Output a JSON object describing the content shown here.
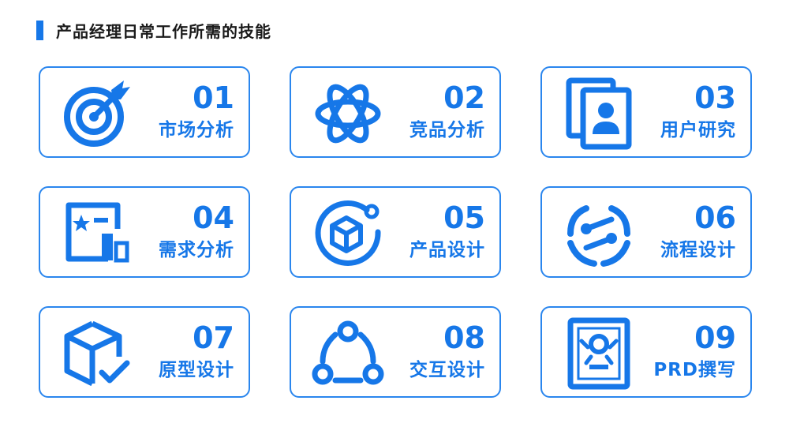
{
  "header": {
    "title": "产品经理日常工作所需的技能"
  },
  "colors": {
    "accent": "#1677e8",
    "border": "#2a86ee"
  },
  "cards": [
    {
      "number": "01",
      "label": "市场分析",
      "icon": "target-icon"
    },
    {
      "number": "02",
      "label": "竞品分析",
      "icon": "atom-icon"
    },
    {
      "number": "03",
      "label": "用户研究",
      "icon": "user-profile-icon"
    },
    {
      "number": "04",
      "label": "需求分析",
      "icon": "requirement-chart-icon"
    },
    {
      "number": "05",
      "label": "产品设计",
      "icon": "cube-orbit-icon"
    },
    {
      "number": "06",
      "label": "流程设计",
      "icon": "flow-cycle-icon"
    },
    {
      "number": "07",
      "label": "原型设计",
      "icon": "box-check-icon"
    },
    {
      "number": "08",
      "label": "交互设计",
      "icon": "interaction-nodes-icon"
    },
    {
      "number": "09",
      "label": "PRD撰写",
      "icon": "document-icon"
    }
  ]
}
